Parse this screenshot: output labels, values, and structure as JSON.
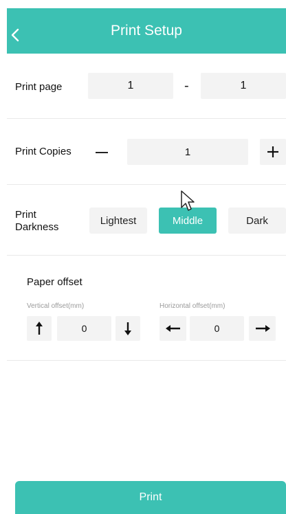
{
  "header": {
    "title": "Print Setup"
  },
  "print_page": {
    "label": "Print page",
    "from": "1",
    "separator": "-",
    "to": "1"
  },
  "print_copies": {
    "label": "Print Copies",
    "value": "1"
  },
  "print_darkness": {
    "label": "Print Darkness",
    "options": [
      "Lightest",
      "Middle",
      "Dark"
    ],
    "selected": "Middle"
  },
  "paper_offset": {
    "title": "Paper offset",
    "vertical": {
      "label": "Vertical offset(mm)",
      "value": "0"
    },
    "horizontal": {
      "label": "Horizontal offset(mm)",
      "value": "0"
    }
  },
  "footer": {
    "print_label": "Print"
  },
  "colors": {
    "accent": "#3cc1b3",
    "field_bg": "#f3f3f3"
  }
}
